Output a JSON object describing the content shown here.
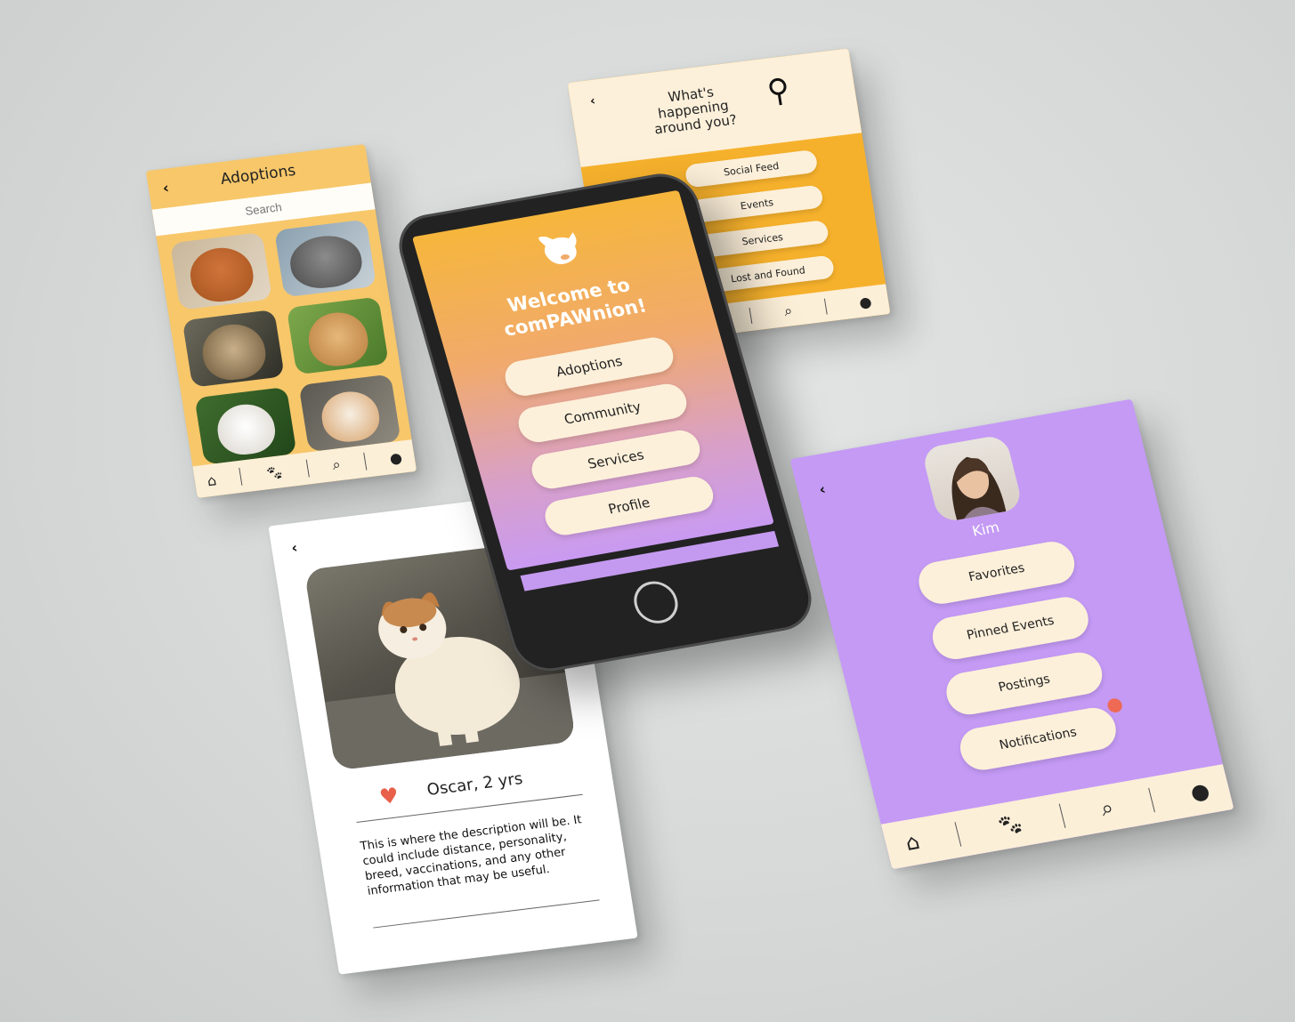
{
  "adoptions": {
    "title": "Adoptions",
    "back": "‹",
    "search_placeholder": "Search",
    "pets": [
      "dog-photo",
      "cat-photo",
      "tabby-cat-photo",
      "shiba-dog-photo",
      "white-dog-photo",
      "white-cat-photo"
    ]
  },
  "happening": {
    "back": "‹",
    "headline_line1": "What's",
    "headline_line2": "happening",
    "headline_line3": "around you?",
    "items": [
      "Social Feed",
      "Events",
      "Services",
      "Lost and Found"
    ]
  },
  "home": {
    "welcome_line1": "Welcome to",
    "welcome_line2": "comPAWnion!",
    "items": [
      "Adoptions",
      "Community",
      "Services",
      "Profile"
    ]
  },
  "detail": {
    "back": "‹",
    "name": "Oscar, 2 yrs",
    "description": "This is where the description will be. It could include distance, personality, breed, vaccinations, and any other information that may be useful."
  },
  "profile": {
    "back": "‹",
    "name": "Kim",
    "items": [
      "Favorites",
      "Pinned Events",
      "Postings",
      "Notifications"
    ]
  },
  "nav_icons": [
    "home-icon",
    "paw-icon",
    "search-icon",
    "person-icon"
  ],
  "colors": {
    "orange": "#f6b12c",
    "light_orange": "#f7c76a",
    "cream": "#fdf0da",
    "purple": "#c49af5",
    "heart": "#e8604a",
    "notification_dot": "#ee6a55"
  }
}
